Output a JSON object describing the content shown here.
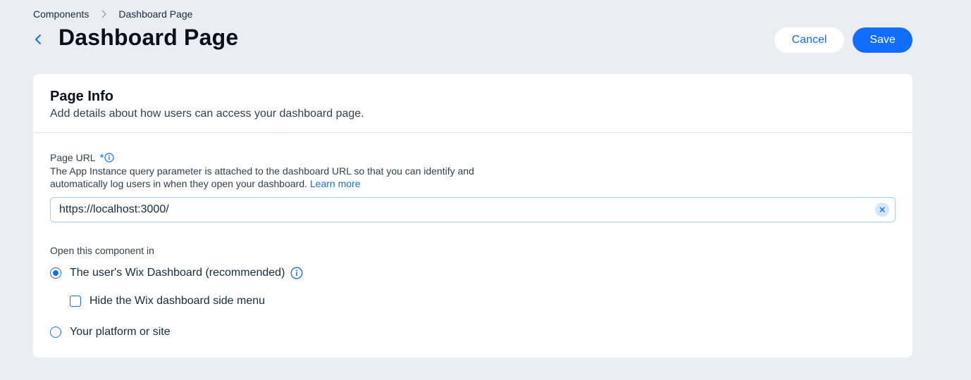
{
  "breadcrumb": {
    "items": [
      "Components",
      "Dashboard Page"
    ]
  },
  "header": {
    "title": "Dashboard Page",
    "cancel_label": "Cancel",
    "save_label": "Save"
  },
  "card": {
    "title": "Page Info",
    "subtitle": "Add details about how users can access your dashboard page."
  },
  "page_url": {
    "label": "Page URL",
    "required_mark": "*",
    "description": "The App Instance query parameter is attached to the dashboard URL so that you can identify and automatically log users in when they open your dashboard.",
    "learn_more": "Learn more",
    "value": "https://localhost:3000/"
  },
  "open_in": {
    "label": "Open this component in",
    "options": [
      {
        "label": "The user's Wix Dashboard (recommended)",
        "selected": true
      },
      {
        "label": "Your platform or site",
        "selected": false
      }
    ],
    "hide_side_menu": {
      "label": "Hide the Wix dashboard side menu",
      "checked": false
    }
  },
  "colors": {
    "accent": "#116dff",
    "background": "#eaedf1",
    "text": "#162d3d"
  }
}
